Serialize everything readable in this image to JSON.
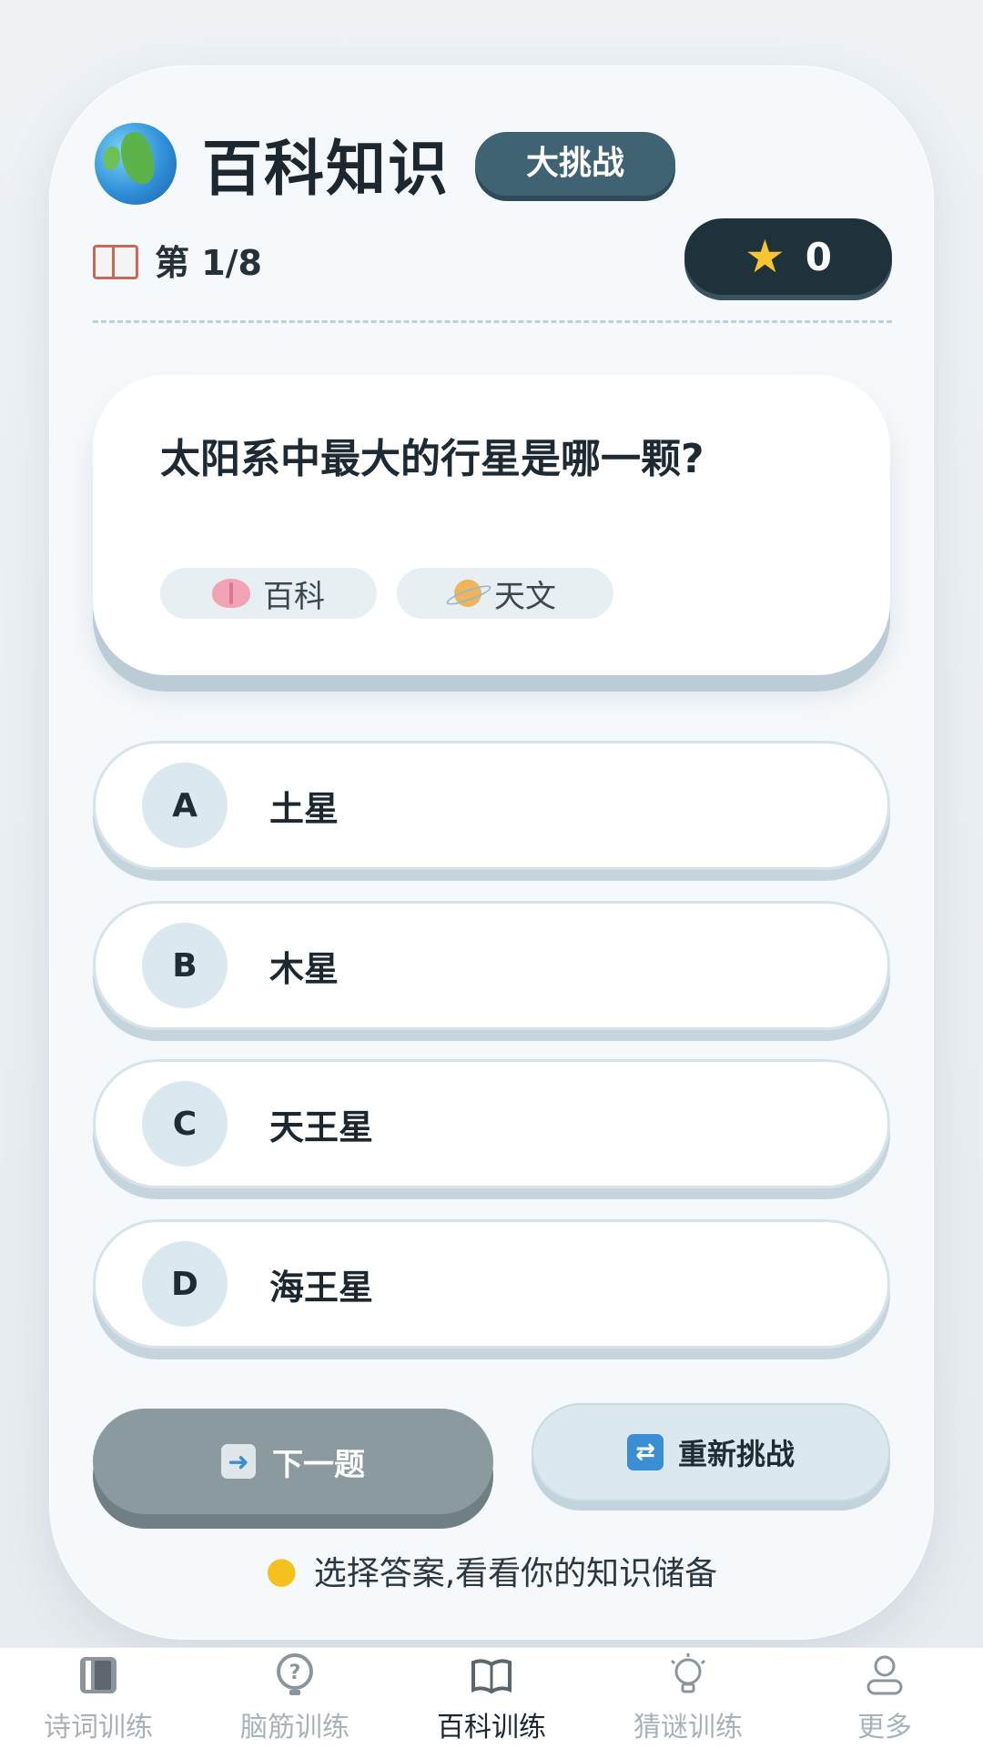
{
  "header": {
    "title": "百科知识",
    "badge": "大挑战"
  },
  "progress": {
    "label": "第 1/8"
  },
  "score": {
    "value": "0"
  },
  "question": {
    "text": "太阳系中最大的行星是哪一颗?",
    "tags": [
      {
        "icon": "brain-icon",
        "label": "百科"
      },
      {
        "icon": "planet-icon",
        "label": "天文"
      }
    ]
  },
  "options": [
    {
      "letter": "A",
      "text": "土星"
    },
    {
      "letter": "B",
      "text": "木星"
    },
    {
      "letter": "C",
      "text": "天王星"
    },
    {
      "letter": "D",
      "text": "海王星"
    }
  ],
  "actions": {
    "next": "下一题",
    "retry": "重新挑战"
  },
  "hint": "选择答案,看看你的知识储备",
  "tabs": [
    {
      "label": "诗词训练",
      "icon": "book-stack-icon",
      "active": false
    },
    {
      "label": "脑筋训练",
      "icon": "question-bubble-icon",
      "active": false
    },
    {
      "label": "百科训练",
      "icon": "open-book-icon",
      "active": true
    },
    {
      "label": "猜谜训练",
      "icon": "lightbulb-icon",
      "active": false
    },
    {
      "label": "更多",
      "icon": "user-icon",
      "active": false
    }
  ],
  "colors": {
    "primary_dark": "#1f313b",
    "badge": "#3f6372",
    "accent_star": "#f7c531"
  }
}
